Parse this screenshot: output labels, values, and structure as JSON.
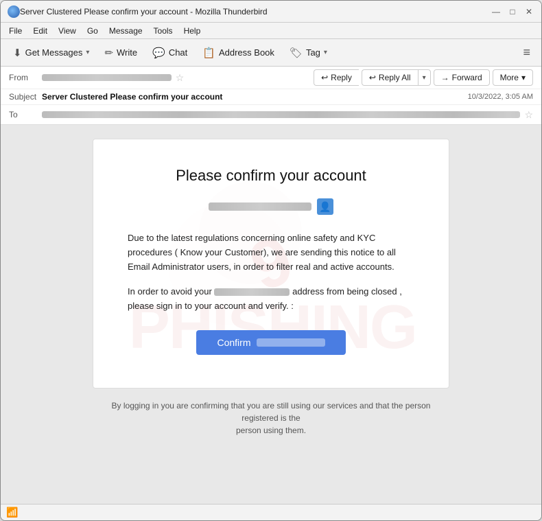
{
  "window": {
    "title": "Server Clustered Please confirm your account - Mozilla Thunderbird",
    "controls": {
      "minimize": "—",
      "maximize": "□",
      "close": "✕"
    }
  },
  "menubar": {
    "items": [
      "File",
      "Edit",
      "View",
      "Go",
      "Message",
      "Tools",
      "Help"
    ]
  },
  "toolbar": {
    "get_messages_label": "Get Messages",
    "write_label": "Write",
    "chat_label": "Chat",
    "address_book_label": "Address Book",
    "tag_label": "Tag",
    "hamburger": "≡"
  },
  "email_header": {
    "from_label": "From",
    "from_value": "",
    "subject_label": "Subject",
    "subject_value": "Server Clustered Please confirm your account",
    "date_value": "10/3/2022, 3:05 AM",
    "to_label": "To",
    "to_value": ""
  },
  "reply_toolbar": {
    "reply_label": "Reply",
    "reply_all_label": "Reply All",
    "forward_label": "Forward",
    "more_label": "More"
  },
  "email_body": {
    "title": "Please confirm your account",
    "recipient_email": "",
    "body_paragraph1": "Due to the latest regulations concerning online safety and KYC procedures ( Know your Customer), we are sending this notice to all Email Administrator users, in order to filter real and active accounts.",
    "body_paragraph2_before": "In order to avoid your",
    "body_paragraph2_after": "address from being closed ,\nplease sign in to your account and verify. :",
    "confirm_button_label": "Confirm",
    "footer_text": "By logging in you are confirming that you are still using our services and that the person registered is the\nperson using them.",
    "watermark_text": "PHISHING"
  },
  "statusbar": {
    "icon": "📶"
  }
}
